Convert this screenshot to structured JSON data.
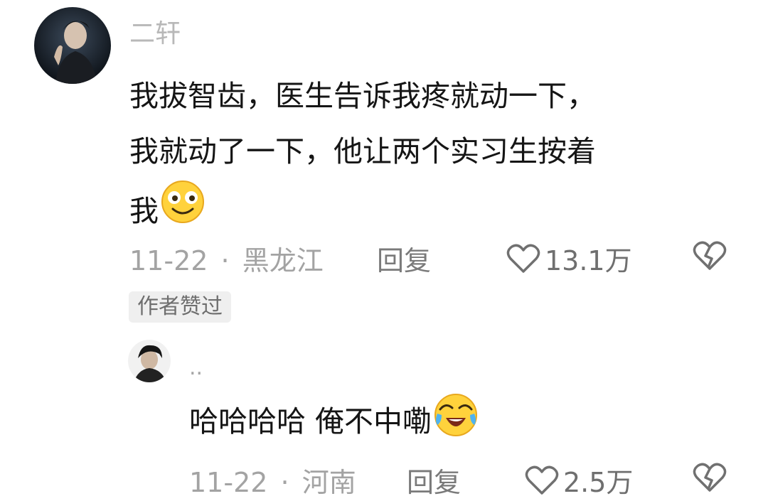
{
  "comment": {
    "username": "二轩",
    "text_lines": [
      "我拔智齿，医生告诉我疼就动一下，",
      "我就动了一下，他让两个实习生按着",
      "我"
    ],
    "emoji": "smiling-face-emoji",
    "date": "11-22",
    "separator": "·",
    "location": "黑龙江",
    "reply_label": "回复",
    "like_count": "13.1万",
    "badge": "作者赞过"
  },
  "reply": {
    "username": "..",
    "text": "哈哈哈哈 俺不中嘞",
    "emoji": "laughing-crying-emoji",
    "date": "11-22",
    "separator": "·",
    "location": "河南",
    "reply_label": "回复",
    "like_count": "2.5万"
  },
  "colors": {
    "background": "#ffffff",
    "text": "#151515",
    "muted": "#a3a3a3",
    "badge_bg": "#efefef",
    "emoji_yellow": "#ffd23c"
  }
}
